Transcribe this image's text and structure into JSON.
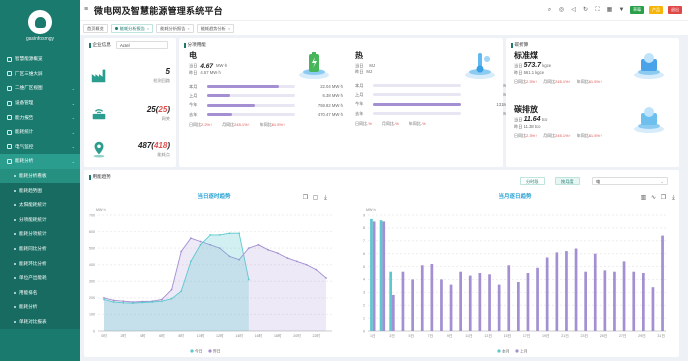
{
  "app": {
    "title": "微电网及智慧能源管理系统平台",
    "brand": "gasinfosmgy"
  },
  "header": {
    "icons": [
      "search-icon",
      "target-icon",
      "volume-icon",
      "refresh-icon",
      "fullscreen-icon",
      "grid-icon",
      "shirt-icon"
    ],
    "btn_green": "草莓",
    "btn_orange": "产品",
    "btn_red": "退出"
  },
  "tabs": [
    {
      "label": "首页概览",
      "active": false
    },
    {
      "label": "能耗分析报告",
      "active": true
    },
    {
      "label": "能耗分析报告",
      "active": false
    },
    {
      "label": "能耗趋势分析",
      "active": false
    }
  ],
  "sidebar": {
    "items": [
      {
        "label": "智慧能源概览",
        "sub": false,
        "caret": false
      },
      {
        "label": "厂区三维大屏",
        "sub": false,
        "caret": false
      },
      {
        "label": "二维厂区视图",
        "sub": false,
        "caret": true
      },
      {
        "label": "设备管理",
        "sub": false,
        "caret": true
      },
      {
        "label": "能力报告",
        "sub": false,
        "caret": true
      },
      {
        "label": "能耗统计",
        "sub": false,
        "caret": true
      },
      {
        "label": "电气监控",
        "sub": false,
        "caret": true
      },
      {
        "label": "能耗分析",
        "sub": false,
        "caret": true,
        "active": true
      },
      {
        "label": "能耗分析看板",
        "sub": true,
        "active": true
      },
      {
        "label": "能耗趋势图",
        "sub": true
      },
      {
        "label": "太阳能耗统计",
        "sub": true
      },
      {
        "label": "分项能耗统计",
        "sub": true
      },
      {
        "label": "能耗分项统计",
        "sub": true
      },
      {
        "label": "能耗同比分析",
        "sub": true
      },
      {
        "label": "能耗环比分析",
        "sub": true
      },
      {
        "label": "单位产出能耗",
        "sub": true
      },
      {
        "label": "用能排名",
        "sub": true
      },
      {
        "label": "能耗分析",
        "sub": true
      },
      {
        "label": "单耗对比报表",
        "sub": true
      }
    ]
  },
  "enterprise": {
    "label": "企业信息",
    "select": "Acrel",
    "stats": [
      {
        "value": "5",
        "red": "",
        "label": "检测回路"
      },
      {
        "value": "25",
        "red": "25",
        "label": "网关"
      },
      {
        "value": "487",
        "red": "418",
        "label": "能耗点"
      }
    ]
  },
  "energy": {
    "label": "分项用能",
    "blocks": [
      {
        "name": "电",
        "today_label": "当日",
        "today": "4.67",
        "today_unit": "MW·h",
        "yday_label": "昨日",
        "yday": "4.57 MW·h",
        "rows": [
          {
            "label": "本月",
            "frac": 0.82,
            "value": "22.04 MW·h"
          },
          {
            "label": "上月",
            "frac": 0.26,
            "value": "6.38 MW·h"
          },
          {
            "label": "今年",
            "frac": 0.55,
            "value": "759.82 MW·h"
          },
          {
            "label": "去年",
            "frac": 0.28,
            "value": "470.47 MW·h"
          }
        ],
        "cmp": {
          "d_label": "日同比",
          "d": "2.2%",
          "m_label": "月同比",
          "m": "245.1%",
          "y_label": "年同比",
          "y": "61.5%"
        }
      },
      {
        "name": "热",
        "today_label": "当日",
        "today": "",
        "today_unit": "MJ",
        "yday_label": "昨日",
        "yday": "MJ",
        "rows": [
          {
            "label": "本月",
            "frac": 0,
            "value": "MJ"
          },
          {
            "label": "上月",
            "frac": 0,
            "value": "MJ"
          },
          {
            "label": "今年",
            "frac": 1.0,
            "value": "131MJ"
          },
          {
            "label": "去年",
            "frac": 0,
            "value": "MJ"
          }
        ],
        "cmp": {
          "d_label": "日同比",
          "d": "-%",
          "m_label": "月同比",
          "m": "-%",
          "y_label": "年同比",
          "y": "-%"
        }
      }
    ]
  },
  "carbon": {
    "label": "碳折算",
    "blocks": [
      {
        "name": "标准煤",
        "today_label": "当日",
        "today": "573.7",
        "unit": "kgce",
        "yday_label": "昨日",
        "yday": "561.1 kgce",
        "d": "2.3%",
        "m": "245.1%",
        "y": "61.5%"
      },
      {
        "name": "碳排放",
        "today_label": "当日",
        "today": "11.64",
        "unit": "tco",
        "yday_label": "昨日",
        "yday": "11.38 tco",
        "d": "2.3%",
        "m": "245.1%",
        "y": "61.5%"
      }
    ],
    "d_label": "日同比",
    "m_label": "月同比",
    "y_label": "年同比"
  },
  "trend": {
    "label": "用能趋势",
    "btn1": "分时段",
    "btn2": "按月度",
    "select": "电"
  },
  "chart_data": [
    {
      "type": "area",
      "title": "当日逐时趋势",
      "ylabel": "MW·h",
      "ylim": [
        0,
        700
      ],
      "yticks": [
        "0",
        "100",
        "200",
        "300",
        "400",
        "500",
        "600",
        "700"
      ],
      "categories": [
        "0时",
        "1时",
        "2时",
        "3时",
        "4时",
        "5时",
        "6时",
        "7时",
        "8时",
        "9时",
        "10时",
        "11时",
        "12时",
        "13时",
        "14时",
        "15时",
        "16时",
        "17时",
        "18时",
        "19时",
        "20时",
        "21时",
        "22时",
        "23时"
      ],
      "xtick_labels": [
        "0时",
        "2时",
        "4时",
        "6时",
        "8时",
        "10时",
        "12时",
        "14时",
        "16时",
        "18时",
        "20时",
        "22时"
      ],
      "series": [
        {
          "name": "今日",
          "color": "#5cc9cf",
          "values": [
            190,
            175,
            170,
            168,
            172,
            175,
            180,
            195,
            240,
            420,
            520,
            580,
            580,
            590,
            590,
            310
          ]
        },
        {
          "name": "昨日",
          "color": "#a38fd1",
          "values": [
            200,
            185,
            180,
            175,
            178,
            180,
            190,
            250,
            480,
            560,
            540,
            520,
            500,
            450,
            430,
            500,
            520,
            490,
            470,
            440,
            420,
            400,
            370,
            320
          ]
        }
      ]
    },
    {
      "type": "bar",
      "title": "当月逐日趋势",
      "ylabel": "MW·h",
      "ylim": [
        0,
        9
      ],
      "yticks": [
        "0",
        "1",
        "2",
        "3",
        "4",
        "5",
        "6",
        "7",
        "8",
        "9"
      ],
      "categories": [
        "1日",
        "2日",
        "3日",
        "4日",
        "5日",
        "6日",
        "7日",
        "8日",
        "9日",
        "10日",
        "11日",
        "12日",
        "13日",
        "14日",
        "15日",
        "16日",
        "17日",
        "18日",
        "19日",
        "20日",
        "21日",
        "22日",
        "23日",
        "24日",
        "25日",
        "26日",
        "27日",
        "28日",
        "29日",
        "30日",
        "31日"
      ],
      "xtick_labels": [
        "1日",
        "3日",
        "5日",
        "7日",
        "9日",
        "11日",
        "13日",
        "15日",
        "17日",
        "19日",
        "21日",
        "23日",
        "25日",
        "27日",
        "29日",
        "31日"
      ],
      "series": [
        {
          "name": "本月",
          "color": "#5cc9cf",
          "values": [
            8.7,
            8.6,
            4.6,
            null,
            null,
            null,
            null,
            null,
            null,
            null,
            null,
            null,
            null,
            null,
            null,
            null,
            null,
            null,
            null,
            null,
            null,
            null,
            null,
            null,
            null,
            null,
            null,
            null,
            null,
            null,
            null
          ]
        },
        {
          "name": "上月",
          "color": "#a38fd1",
          "values": [
            8.5,
            8.5,
            2.8,
            4.6,
            4.0,
            5.1,
            5.2,
            4.0,
            3.6,
            4.6,
            4.3,
            4.5,
            4.4,
            3.6,
            5.1,
            3.8,
            4.5,
            4.9,
            5.7,
            6.1,
            6.2,
            6.4,
            4.6,
            6.0,
            4.7,
            4.6,
            5.4,
            4.6,
            4.5,
            3.4,
            7.4
          ]
        }
      ]
    }
  ]
}
